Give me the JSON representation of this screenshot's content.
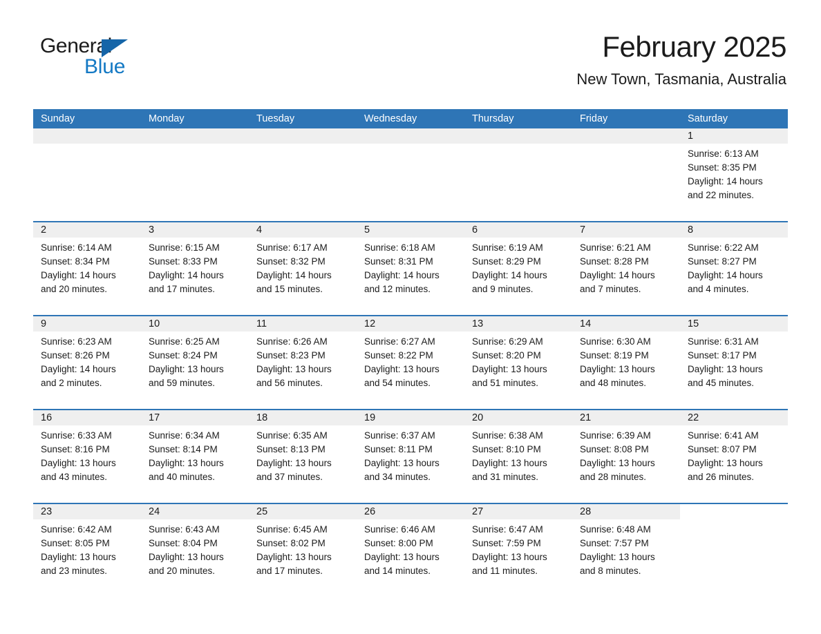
{
  "logo": {
    "word_one": "General",
    "word_two": "Blue",
    "triangle": "blue-triangle-icon"
  },
  "header": {
    "month_title": "February 2025",
    "location": "New Town, Tasmania, Australia"
  },
  "colors": {
    "header_blue": "#2e75b6",
    "date_strip_gray": "#efefef",
    "logo_blue": "#1479c4",
    "text": "#1b1b1b"
  },
  "weekdays": [
    "Sunday",
    "Monday",
    "Tuesday",
    "Wednesday",
    "Thursday",
    "Friday",
    "Saturday"
  ],
  "labels": {
    "sunrise_prefix": "Sunrise: ",
    "sunset_prefix": "Sunset: ",
    "daylight_prefix": "Daylight: "
  },
  "weeks": [
    [
      {
        "day": "",
        "empty": true
      },
      {
        "day": "",
        "empty": true
      },
      {
        "day": "",
        "empty": true
      },
      {
        "day": "",
        "empty": true
      },
      {
        "day": "",
        "empty": true
      },
      {
        "day": "",
        "empty": true
      },
      {
        "day": "1",
        "sunrise": "Sunrise: 6:13 AM",
        "sunset": "Sunset: 8:35 PM",
        "daylight": "Daylight: 14 hours and 22 minutes."
      }
    ],
    [
      {
        "day": "2",
        "sunrise": "Sunrise: 6:14 AM",
        "sunset": "Sunset: 8:34 PM",
        "daylight": "Daylight: 14 hours and 20 minutes."
      },
      {
        "day": "3",
        "sunrise": "Sunrise: 6:15 AM",
        "sunset": "Sunset: 8:33 PM",
        "daylight": "Daylight: 14 hours and 17 minutes."
      },
      {
        "day": "4",
        "sunrise": "Sunrise: 6:17 AM",
        "sunset": "Sunset: 8:32 PM",
        "daylight": "Daylight: 14 hours and 15 minutes."
      },
      {
        "day": "5",
        "sunrise": "Sunrise: 6:18 AM",
        "sunset": "Sunset: 8:31 PM",
        "daylight": "Daylight: 14 hours and 12 minutes."
      },
      {
        "day": "6",
        "sunrise": "Sunrise: 6:19 AM",
        "sunset": "Sunset: 8:29 PM",
        "daylight": "Daylight: 14 hours and 9 minutes."
      },
      {
        "day": "7",
        "sunrise": "Sunrise: 6:21 AM",
        "sunset": "Sunset: 8:28 PM",
        "daylight": "Daylight: 14 hours and 7 minutes."
      },
      {
        "day": "8",
        "sunrise": "Sunrise: 6:22 AM",
        "sunset": "Sunset: 8:27 PM",
        "daylight": "Daylight: 14 hours and 4 minutes."
      }
    ],
    [
      {
        "day": "9",
        "sunrise": "Sunrise: 6:23 AM",
        "sunset": "Sunset: 8:26 PM",
        "daylight": "Daylight: 14 hours and 2 minutes."
      },
      {
        "day": "10",
        "sunrise": "Sunrise: 6:25 AM",
        "sunset": "Sunset: 8:24 PM",
        "daylight": "Daylight: 13 hours and 59 minutes."
      },
      {
        "day": "11",
        "sunrise": "Sunrise: 6:26 AM",
        "sunset": "Sunset: 8:23 PM",
        "daylight": "Daylight: 13 hours and 56 minutes."
      },
      {
        "day": "12",
        "sunrise": "Sunrise: 6:27 AM",
        "sunset": "Sunset: 8:22 PM",
        "daylight": "Daylight: 13 hours and 54 minutes."
      },
      {
        "day": "13",
        "sunrise": "Sunrise: 6:29 AM",
        "sunset": "Sunset: 8:20 PM",
        "daylight": "Daylight: 13 hours and 51 minutes."
      },
      {
        "day": "14",
        "sunrise": "Sunrise: 6:30 AM",
        "sunset": "Sunset: 8:19 PM",
        "daylight": "Daylight: 13 hours and 48 minutes."
      },
      {
        "day": "15",
        "sunrise": "Sunrise: 6:31 AM",
        "sunset": "Sunset: 8:17 PM",
        "daylight": "Daylight: 13 hours and 45 minutes."
      }
    ],
    [
      {
        "day": "16",
        "sunrise": "Sunrise: 6:33 AM",
        "sunset": "Sunset: 8:16 PM",
        "daylight": "Daylight: 13 hours and 43 minutes."
      },
      {
        "day": "17",
        "sunrise": "Sunrise: 6:34 AM",
        "sunset": "Sunset: 8:14 PM",
        "daylight": "Daylight: 13 hours and 40 minutes."
      },
      {
        "day": "18",
        "sunrise": "Sunrise: 6:35 AM",
        "sunset": "Sunset: 8:13 PM",
        "daylight": "Daylight: 13 hours and 37 minutes."
      },
      {
        "day": "19",
        "sunrise": "Sunrise: 6:37 AM",
        "sunset": "Sunset: 8:11 PM",
        "daylight": "Daylight: 13 hours and 34 minutes."
      },
      {
        "day": "20",
        "sunrise": "Sunrise: 6:38 AM",
        "sunset": "Sunset: 8:10 PM",
        "daylight": "Daylight: 13 hours and 31 minutes."
      },
      {
        "day": "21",
        "sunrise": "Sunrise: 6:39 AM",
        "sunset": "Sunset: 8:08 PM",
        "daylight": "Daylight: 13 hours and 28 minutes."
      },
      {
        "day": "22",
        "sunrise": "Sunrise: 6:41 AM",
        "sunset": "Sunset: 8:07 PM",
        "daylight": "Daylight: 13 hours and 26 minutes."
      }
    ],
    [
      {
        "day": "23",
        "sunrise": "Sunrise: 6:42 AM",
        "sunset": "Sunset: 8:05 PM",
        "daylight": "Daylight: 13 hours and 23 minutes."
      },
      {
        "day": "24",
        "sunrise": "Sunrise: 6:43 AM",
        "sunset": "Sunset: 8:04 PM",
        "daylight": "Daylight: 13 hours and 20 minutes."
      },
      {
        "day": "25",
        "sunrise": "Sunrise: 6:45 AM",
        "sunset": "Sunset: 8:02 PM",
        "daylight": "Daylight: 13 hours and 17 minutes."
      },
      {
        "day": "26",
        "sunrise": "Sunrise: 6:46 AM",
        "sunset": "Sunset: 8:00 PM",
        "daylight": "Daylight: 13 hours and 14 minutes."
      },
      {
        "day": "27",
        "sunrise": "Sunrise: 6:47 AM",
        "sunset": "Sunset: 7:59 PM",
        "daylight": "Daylight: 13 hours and 11 minutes."
      },
      {
        "day": "28",
        "sunrise": "Sunrise: 6:48 AM",
        "sunset": "Sunset: 7:57 PM",
        "daylight": "Daylight: 13 hours and 8 minutes."
      },
      {
        "day": "",
        "blank": true
      }
    ]
  ]
}
